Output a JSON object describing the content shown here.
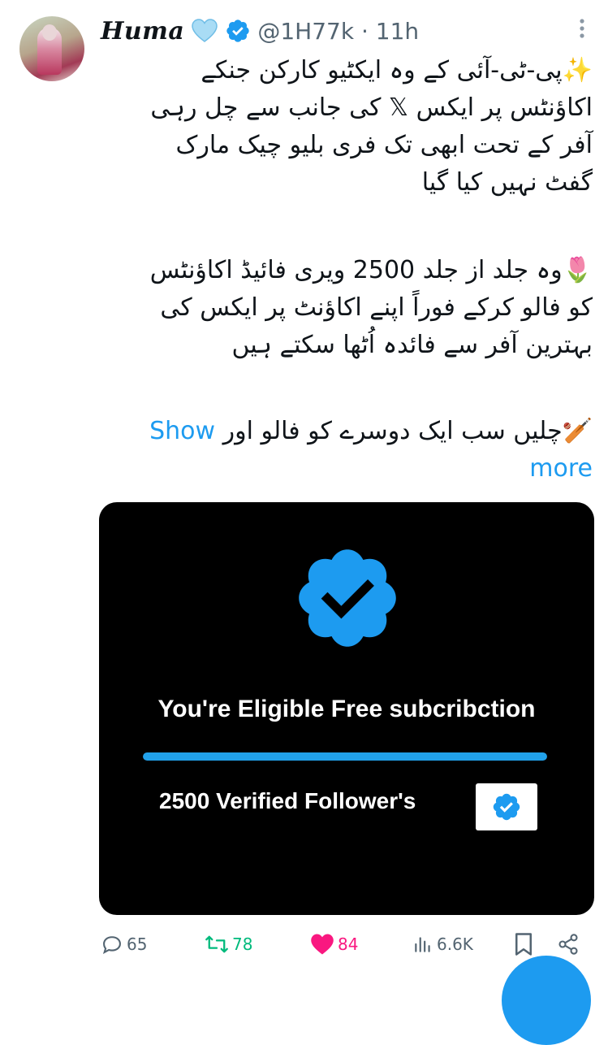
{
  "tweet": {
    "display_name": "Huma",
    "handle_time": "@1H77k · 11h",
    "paragraphs": [
      [
        "✨پی-ٹی-آئی کے وہ ایکٹیو کارکن جنکے",
        "اکاؤنٹس پر ایکس 𝕏 کی جانب سے چل رہی",
        "آفر کے تحت ابھی تک فری بلیو چیک مارک",
        "گفٹ نہیں کیا گیا"
      ],
      [
        "🌷وہ جلد از جلد 2500 ویری فائیڈ اکاؤنٹس",
        "کو فالو کرکے فوراً اپنے اکاؤنٹ پر ایکس کی",
        "بہترین آفر سے فائدہ اُٹھا سکتے ہیں"
      ]
    ],
    "last_line": "🏏چلیں سب ایک دوسرے کو فالو اور",
    "show_more": [
      "Show",
      "more"
    ]
  },
  "media": {
    "eligible_text": "You're Eligible Free subcribction",
    "followers_text": "2500 Verified Follower's",
    "bar_fill_fraction": 1.0
  },
  "actions": {
    "replies": "65",
    "retweets": "78",
    "likes": "84",
    "views": "6.6K"
  },
  "colors": {
    "accent": "#1d9bf0",
    "like": "#f91880",
    "retweet": "#00ba7c",
    "muted": "#536471",
    "badge": "#1d9bf0"
  },
  "icons": [
    "more-icon",
    "heart-emoji-icon",
    "verified-icon",
    "reply-icon",
    "retweet-icon",
    "like-icon",
    "views-icon",
    "bookmark-icon",
    "share-icon",
    "verified-badge-icon",
    "checkmark-icon"
  ]
}
